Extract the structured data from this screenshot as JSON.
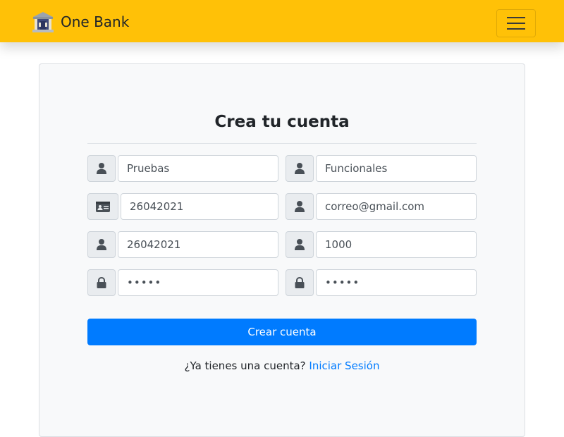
{
  "header": {
    "brand_name": "One Bank",
    "brand_icon": "bank-building-icon",
    "menu_icon": "hamburger-menu-icon",
    "background_color": "#ffc107"
  },
  "form": {
    "title": "Crea tu cuenta",
    "fields": {
      "first_name": {
        "value": "Pruebas",
        "icon": "user-icon"
      },
      "last_name": {
        "value": "Funcionales",
        "icon": "user-icon"
      },
      "id_number": {
        "value": "26042021",
        "icon": "id-card-icon"
      },
      "email": {
        "value": "correo@gmail.com",
        "icon": "user-icon"
      },
      "field5": {
        "value": "26042021",
        "icon": "user-icon"
      },
      "field6": {
        "value": "1000",
        "icon": "user-icon"
      },
      "password": {
        "value": "•••••",
        "icon": "lock-icon"
      },
      "confirm_password": {
        "value": "•••••",
        "icon": "lock-icon"
      }
    },
    "submit_label": "Crear cuenta",
    "submit_color": "#007bff",
    "login_prompt": "¿Ya tienes una cuenta?",
    "login_link": "Iniciar Sesión"
  }
}
